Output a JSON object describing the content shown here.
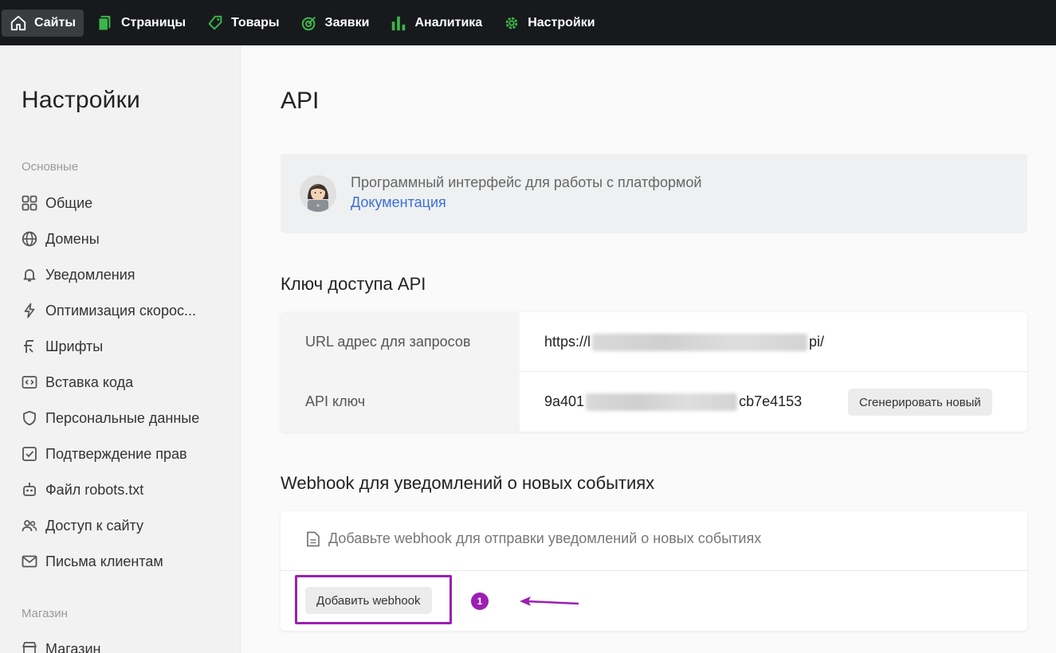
{
  "topnav": {
    "items": [
      {
        "label": "Сайты",
        "icon": "home-icon",
        "active": true
      },
      {
        "label": "Страницы",
        "icon": "pages-icon"
      },
      {
        "label": "Товары",
        "icon": "tag-icon"
      },
      {
        "label": "Заявки",
        "icon": "target-icon"
      },
      {
        "label": "Аналитика",
        "icon": "bar-chart-icon"
      },
      {
        "label": "Настройки",
        "icon": "gear-icon"
      }
    ],
    "accent": "#3cb54a"
  },
  "sidebar": {
    "title": "Настройки",
    "section_main": "Основные",
    "items": [
      {
        "label": "Общие",
        "icon": "grid-icon"
      },
      {
        "label": "Домены",
        "icon": "globe-icon"
      },
      {
        "label": "Уведомления",
        "icon": "bell-icon"
      },
      {
        "label": "Оптимизация скорос...",
        "icon": "lightning-icon"
      },
      {
        "label": "Шрифты",
        "icon": "font-icon"
      },
      {
        "label": "Вставка кода",
        "icon": "code-icon"
      },
      {
        "label": "Персональные данные",
        "icon": "shield-icon"
      },
      {
        "label": "Подтверждение прав",
        "icon": "checkbox-icon"
      },
      {
        "label": "Файл robots.txt",
        "icon": "robot-icon"
      },
      {
        "label": "Доступ к сайту",
        "icon": "users-icon"
      },
      {
        "label": "Письма клиентам",
        "icon": "mail-icon"
      }
    ],
    "section_shop": "Магазин",
    "shop_items": [
      {
        "label": "Магазин",
        "icon": "shop-icon"
      }
    ]
  },
  "main": {
    "title": "API",
    "info": {
      "text": "Программный интерфейс для работы с платформой",
      "link": "Документация"
    },
    "api_section": {
      "heading": "Ключ доступа API",
      "url_label": "URL адрес для запросов",
      "url_prefix": "https://l",
      "url_suffix": "pi/",
      "key_label": "API ключ",
      "key_prefix": "9a401",
      "key_suffix": "cb7e4153",
      "generate_button": "Сгенерировать новый"
    },
    "webhook_section": {
      "heading": "Webhook для уведомлений о новых событиях",
      "hint": "Добавьте webhook для отправки уведомлений о новых событиях",
      "add_button": "Добавить webhook",
      "annotation_number": "1",
      "annotation_color": "#9b1fb3"
    }
  }
}
